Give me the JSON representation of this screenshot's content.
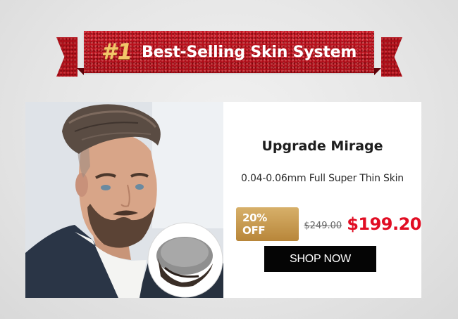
{
  "banner": {
    "rank": "#1",
    "headline": "Best-Selling Skin System"
  },
  "product": {
    "name": "Upgrade Mirage",
    "description": "0.04-0.06mm Full Super Thin Skin",
    "discount_badge": "20% OFF",
    "original_price": "$249.00",
    "sale_price": "$199.20",
    "cta_label": "SHOP NOW"
  },
  "images": {
    "model_photo": "man-with-hair-system-photo",
    "inset": "hair-system-unit-thumbnail"
  },
  "colors": {
    "ribbon_red": "#b0101a",
    "rank_gold": "#f3c66a",
    "badge_gold": "#c89a4e",
    "sale_red": "#e10d23",
    "button_black": "#050505"
  }
}
